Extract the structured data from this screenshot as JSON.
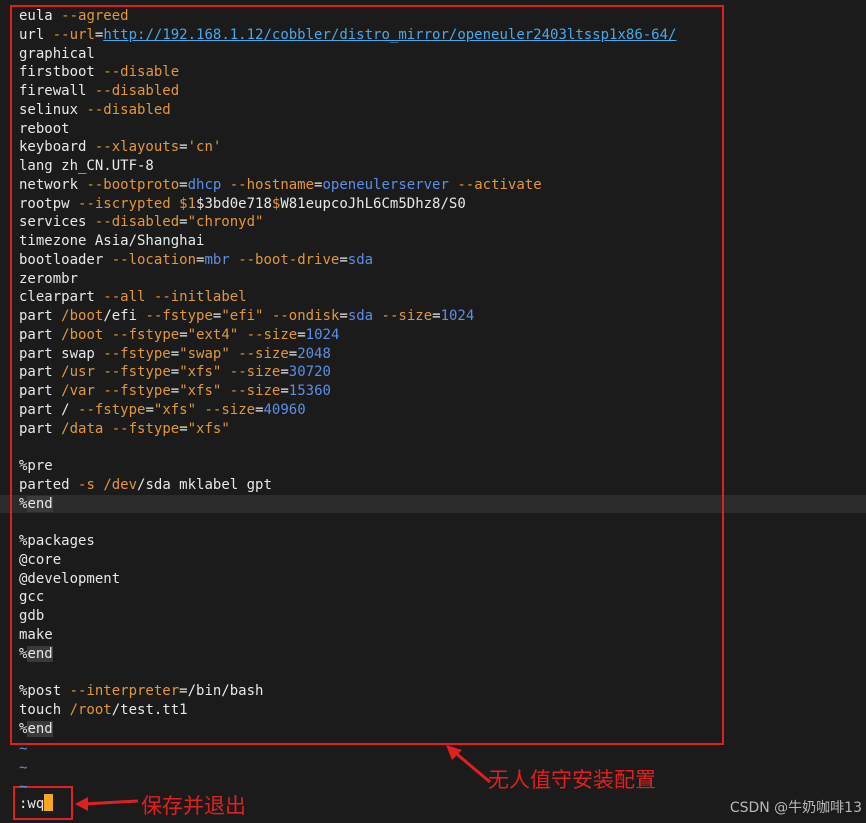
{
  "editor": {
    "lines": [
      [
        {
          "t": "eula ",
          "c": "plain"
        },
        {
          "t": "--agreed",
          "c": "opt"
        }
      ],
      [
        {
          "t": "url ",
          "c": "plain"
        },
        {
          "t": "--url",
          "c": "opt"
        },
        {
          "t": "=",
          "c": "plain"
        },
        {
          "t": "http://192.168.1.12/cobbler/distro_mirror/openeuler2403ltssp1x86-64/",
          "c": "url"
        }
      ],
      [
        {
          "t": "graphical",
          "c": "plain"
        }
      ],
      [
        {
          "t": "firstboot ",
          "c": "plain"
        },
        {
          "t": "--disable",
          "c": "opt"
        }
      ],
      [
        {
          "t": "firewall ",
          "c": "plain"
        },
        {
          "t": "--disabled",
          "c": "opt"
        }
      ],
      [
        {
          "t": "selinux ",
          "c": "plain"
        },
        {
          "t": "--disabled",
          "c": "opt"
        }
      ],
      [
        {
          "t": "reboot",
          "c": "plain"
        }
      ],
      [
        {
          "t": "keyboard ",
          "c": "plain"
        },
        {
          "t": "--xlayouts",
          "c": "opt"
        },
        {
          "t": "=",
          "c": "plain"
        },
        {
          "t": "'cn'",
          "c": "str"
        }
      ],
      [
        {
          "t": "lang zh_CN.UTF-8",
          "c": "plain"
        }
      ],
      [
        {
          "t": "network ",
          "c": "plain"
        },
        {
          "t": "--bootproto",
          "c": "opt"
        },
        {
          "t": "=",
          "c": "plain"
        },
        {
          "t": "dhcp",
          "c": "val"
        },
        {
          "t": " ",
          "c": "plain"
        },
        {
          "t": "--hostname",
          "c": "opt"
        },
        {
          "t": "=",
          "c": "plain"
        },
        {
          "t": "openeulerserver",
          "c": "val"
        },
        {
          "t": " ",
          "c": "plain"
        },
        {
          "t": "--activate",
          "c": "opt"
        }
      ],
      [
        {
          "t": "rootpw ",
          "c": "plain"
        },
        {
          "t": "--iscrypted",
          "c": "opt"
        },
        {
          "t": " ",
          "c": "plain"
        },
        {
          "t": "$1",
          "c": "str"
        },
        {
          "t": "$3bd0e718",
          "c": "plain"
        },
        {
          "t": "$",
          "c": "str"
        },
        {
          "t": "W81eupcoJhL6Cm5Dhz8/S0",
          "c": "plain"
        }
      ],
      [
        {
          "t": "services ",
          "c": "plain"
        },
        {
          "t": "--disabled",
          "c": "opt"
        },
        {
          "t": "=",
          "c": "plain"
        },
        {
          "t": "\"chronyd\"",
          "c": "str"
        }
      ],
      [
        {
          "t": "timezone Asia/Shanghai",
          "c": "plain"
        }
      ],
      [
        {
          "t": "bootloader ",
          "c": "plain"
        },
        {
          "t": "--location",
          "c": "opt"
        },
        {
          "t": "=",
          "c": "plain"
        },
        {
          "t": "mbr",
          "c": "val"
        },
        {
          "t": " ",
          "c": "plain"
        },
        {
          "t": "--boot-drive",
          "c": "opt"
        },
        {
          "t": "=",
          "c": "plain"
        },
        {
          "t": "sda",
          "c": "val"
        }
      ],
      [
        {
          "t": "zerombr",
          "c": "plain"
        }
      ],
      [
        {
          "t": "clearpart ",
          "c": "plain"
        },
        {
          "t": "--all",
          "c": "opt"
        },
        {
          "t": " ",
          "c": "plain"
        },
        {
          "t": "--initlabel",
          "c": "opt"
        }
      ],
      [
        {
          "t": "part ",
          "c": "plain"
        },
        {
          "t": "/boot",
          "c": "path"
        },
        {
          "t": "/efi ",
          "c": "plain"
        },
        {
          "t": "--fstype",
          "c": "opt"
        },
        {
          "t": "=",
          "c": "plain"
        },
        {
          "t": "\"efi\"",
          "c": "str"
        },
        {
          "t": " ",
          "c": "plain"
        },
        {
          "t": "--ondisk",
          "c": "opt"
        },
        {
          "t": "=",
          "c": "plain"
        },
        {
          "t": "sda",
          "c": "val"
        },
        {
          "t": " ",
          "c": "plain"
        },
        {
          "t": "--size",
          "c": "opt"
        },
        {
          "t": "=",
          "c": "plain"
        },
        {
          "t": "1024",
          "c": "val"
        }
      ],
      [
        {
          "t": "part ",
          "c": "plain"
        },
        {
          "t": "/boot",
          "c": "path"
        },
        {
          "t": " ",
          "c": "plain"
        },
        {
          "t": "--fstype",
          "c": "opt"
        },
        {
          "t": "=",
          "c": "plain"
        },
        {
          "t": "\"ext4\"",
          "c": "str"
        },
        {
          "t": " ",
          "c": "plain"
        },
        {
          "t": "--size",
          "c": "opt"
        },
        {
          "t": "=",
          "c": "plain"
        },
        {
          "t": "1024",
          "c": "val"
        }
      ],
      [
        {
          "t": "part swap ",
          "c": "plain"
        },
        {
          "t": "--fstype",
          "c": "opt"
        },
        {
          "t": "=",
          "c": "plain"
        },
        {
          "t": "\"swap\"",
          "c": "str"
        },
        {
          "t": " ",
          "c": "plain"
        },
        {
          "t": "--size",
          "c": "opt"
        },
        {
          "t": "=",
          "c": "plain"
        },
        {
          "t": "2048",
          "c": "val"
        }
      ],
      [
        {
          "t": "part ",
          "c": "plain"
        },
        {
          "t": "/usr",
          "c": "path"
        },
        {
          "t": " ",
          "c": "plain"
        },
        {
          "t": "--fstype",
          "c": "opt"
        },
        {
          "t": "=",
          "c": "plain"
        },
        {
          "t": "\"xfs\"",
          "c": "str"
        },
        {
          "t": " ",
          "c": "plain"
        },
        {
          "t": "--size",
          "c": "opt"
        },
        {
          "t": "=",
          "c": "plain"
        },
        {
          "t": "30720",
          "c": "val"
        }
      ],
      [
        {
          "t": "part ",
          "c": "plain"
        },
        {
          "t": "/var",
          "c": "path"
        },
        {
          "t": " ",
          "c": "plain"
        },
        {
          "t": "--fstype",
          "c": "opt"
        },
        {
          "t": "=",
          "c": "plain"
        },
        {
          "t": "\"xfs\"",
          "c": "str"
        },
        {
          "t": " ",
          "c": "plain"
        },
        {
          "t": "--size",
          "c": "opt"
        },
        {
          "t": "=",
          "c": "plain"
        },
        {
          "t": "15360",
          "c": "val"
        }
      ],
      [
        {
          "t": "part / ",
          "c": "plain"
        },
        {
          "t": "--fstype",
          "c": "opt"
        },
        {
          "t": "=",
          "c": "plain"
        },
        {
          "t": "\"xfs\"",
          "c": "str"
        },
        {
          "t": " ",
          "c": "plain"
        },
        {
          "t": "--size",
          "c": "opt"
        },
        {
          "t": "=",
          "c": "plain"
        },
        {
          "t": "40960",
          "c": "val"
        }
      ],
      [
        {
          "t": "part ",
          "c": "plain"
        },
        {
          "t": "/data",
          "c": "path"
        },
        {
          "t": " ",
          "c": "plain"
        },
        {
          "t": "--fstype",
          "c": "opt"
        },
        {
          "t": "=",
          "c": "plain"
        },
        {
          "t": "\"xfs\"",
          "c": "str"
        }
      ],
      [],
      [
        {
          "t": "%pre",
          "c": "pct"
        }
      ],
      [
        {
          "t": "parted ",
          "c": "plain"
        },
        {
          "t": "-s",
          "c": "opt"
        },
        {
          "t": " ",
          "c": "plain"
        },
        {
          "t": "/dev",
          "c": "path"
        },
        {
          "t": "/sda mklabel gpt",
          "c": "plain"
        }
      ],
      [
        {
          "t": "%",
          "c": "pct"
        },
        {
          "t": "end",
          "c": "kw"
        }
      ],
      [],
      [
        {
          "t": "%packages",
          "c": "pct"
        }
      ],
      [
        {
          "t": "@core",
          "c": "plain"
        }
      ],
      [
        {
          "t": "@development",
          "c": "plain"
        }
      ],
      [
        {
          "t": "gcc",
          "c": "plain"
        }
      ],
      [
        {
          "t": "gdb",
          "c": "plain"
        }
      ],
      [
        {
          "t": "make",
          "c": "plain"
        }
      ],
      [
        {
          "t": "%",
          "c": "pct"
        },
        {
          "t": "end",
          "c": "kw"
        }
      ],
      [],
      [
        {
          "t": "%post ",
          "c": "pct"
        },
        {
          "t": "--interpreter",
          "c": "opt"
        },
        {
          "t": "=/bin/bash",
          "c": "plain"
        }
      ],
      [
        {
          "t": "touch ",
          "c": "plain"
        },
        {
          "t": "/root",
          "c": "path"
        },
        {
          "t": "/test.tt1",
          "c": "plain"
        }
      ],
      [
        {
          "t": "%",
          "c": "pct"
        },
        {
          "t": "end",
          "c": "kw"
        }
      ]
    ],
    "tildes": [
      "~",
      "~",
      "~"
    ],
    "command": ":wq"
  },
  "annotations": {
    "config_label": "无人值守安装配置",
    "save_label": "保存并退出"
  },
  "watermark": "CSDN @牛奶咖啡13"
}
